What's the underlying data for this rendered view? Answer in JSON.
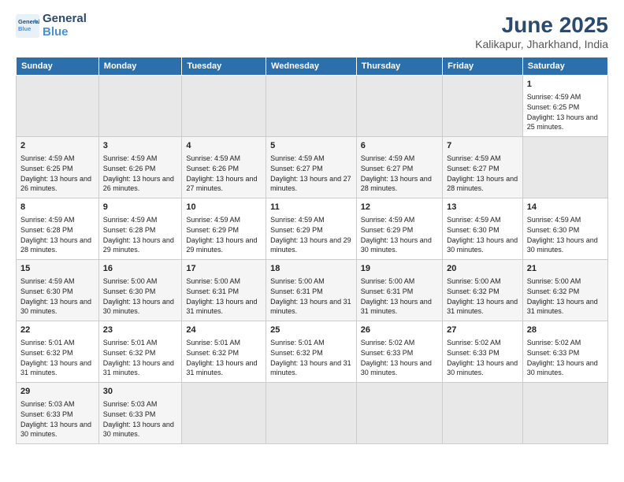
{
  "header": {
    "logo_general": "General",
    "logo_blue": "Blue",
    "title": "June 2025",
    "subtitle": "Kalikapur, Jharkhand, India"
  },
  "calendar": {
    "days": [
      "Sunday",
      "Monday",
      "Tuesday",
      "Wednesday",
      "Thursday",
      "Friday",
      "Saturday"
    ],
    "weeks": [
      [
        null,
        null,
        null,
        null,
        null,
        null,
        {
          "day": "1",
          "sunrise": "Sunrise: 4:59 AM",
          "sunset": "Sunset: 6:25 PM",
          "daylight": "Daylight: 13 hours and 25 minutes."
        }
      ],
      [
        {
          "day": "2",
          "sunrise": "Sunrise: 4:59 AM",
          "sunset": "Sunset: 6:25 PM",
          "daylight": "Daylight: 13 hours and 26 minutes."
        },
        {
          "day": "3",
          "sunrise": "Sunrise: 4:59 AM",
          "sunset": "Sunset: 6:26 PM",
          "daylight": "Daylight: 13 hours and 26 minutes."
        },
        {
          "day": "4",
          "sunrise": "Sunrise: 4:59 AM",
          "sunset": "Sunset: 6:26 PM",
          "daylight": "Daylight: 13 hours and 27 minutes."
        },
        {
          "day": "5",
          "sunrise": "Sunrise: 4:59 AM",
          "sunset": "Sunset: 6:27 PM",
          "daylight": "Daylight: 13 hours and 27 minutes."
        },
        {
          "day": "6",
          "sunrise": "Sunrise: 4:59 AM",
          "sunset": "Sunset: 6:27 PM",
          "daylight": "Daylight: 13 hours and 28 minutes."
        },
        {
          "day": "7",
          "sunrise": "Sunrise: 4:59 AM",
          "sunset": "Sunset: 6:27 PM",
          "daylight": "Daylight: 13 hours and 28 minutes."
        },
        null
      ],
      [
        {
          "day": "8",
          "sunrise": "Sunrise: 4:59 AM",
          "sunset": "Sunset: 6:28 PM",
          "daylight": "Daylight: 13 hours and 28 minutes."
        },
        {
          "day": "9",
          "sunrise": "Sunrise: 4:59 AM",
          "sunset": "Sunset: 6:28 PM",
          "daylight": "Daylight: 13 hours and 29 minutes."
        },
        {
          "day": "10",
          "sunrise": "Sunrise: 4:59 AM",
          "sunset": "Sunset: 6:29 PM",
          "daylight": "Daylight: 13 hours and 29 minutes."
        },
        {
          "day": "11",
          "sunrise": "Sunrise: 4:59 AM",
          "sunset": "Sunset: 6:29 PM",
          "daylight": "Daylight: 13 hours and 29 minutes."
        },
        {
          "day": "12",
          "sunrise": "Sunrise: 4:59 AM",
          "sunset": "Sunset: 6:29 PM",
          "daylight": "Daylight: 13 hours and 30 minutes."
        },
        {
          "day": "13",
          "sunrise": "Sunrise: 4:59 AM",
          "sunset": "Sunset: 6:30 PM",
          "daylight": "Daylight: 13 hours and 30 minutes."
        },
        {
          "day": "14",
          "sunrise": "Sunrise: 4:59 AM",
          "sunset": "Sunset: 6:30 PM",
          "daylight": "Daylight: 13 hours and 30 minutes."
        }
      ],
      [
        {
          "day": "15",
          "sunrise": "Sunrise: 4:59 AM",
          "sunset": "Sunset: 6:30 PM",
          "daylight": "Daylight: 13 hours and 30 minutes."
        },
        {
          "day": "16",
          "sunrise": "Sunrise: 5:00 AM",
          "sunset": "Sunset: 6:30 PM",
          "daylight": "Daylight: 13 hours and 30 minutes."
        },
        {
          "day": "17",
          "sunrise": "Sunrise: 5:00 AM",
          "sunset": "Sunset: 6:31 PM",
          "daylight": "Daylight: 13 hours and 31 minutes."
        },
        {
          "day": "18",
          "sunrise": "Sunrise: 5:00 AM",
          "sunset": "Sunset: 6:31 PM",
          "daylight": "Daylight: 13 hours and 31 minutes."
        },
        {
          "day": "19",
          "sunrise": "Sunrise: 5:00 AM",
          "sunset": "Sunset: 6:31 PM",
          "daylight": "Daylight: 13 hours and 31 minutes."
        },
        {
          "day": "20",
          "sunrise": "Sunrise: 5:00 AM",
          "sunset": "Sunset: 6:32 PM",
          "daylight": "Daylight: 13 hours and 31 minutes."
        },
        {
          "day": "21",
          "sunrise": "Sunrise: 5:00 AM",
          "sunset": "Sunset: 6:32 PM",
          "daylight": "Daylight: 13 hours and 31 minutes."
        }
      ],
      [
        {
          "day": "22",
          "sunrise": "Sunrise: 5:01 AM",
          "sunset": "Sunset: 6:32 PM",
          "daylight": "Daylight: 13 hours and 31 minutes."
        },
        {
          "day": "23",
          "sunrise": "Sunrise: 5:01 AM",
          "sunset": "Sunset: 6:32 PM",
          "daylight": "Daylight: 13 hours and 31 minutes."
        },
        {
          "day": "24",
          "sunrise": "Sunrise: 5:01 AM",
          "sunset": "Sunset: 6:32 PM",
          "daylight": "Daylight: 13 hours and 31 minutes."
        },
        {
          "day": "25",
          "sunrise": "Sunrise: 5:01 AM",
          "sunset": "Sunset: 6:32 PM",
          "daylight": "Daylight: 13 hours and 31 minutes."
        },
        {
          "day": "26",
          "sunrise": "Sunrise: 5:02 AM",
          "sunset": "Sunset: 6:33 PM",
          "daylight": "Daylight: 13 hours and 30 minutes."
        },
        {
          "day": "27",
          "sunrise": "Sunrise: 5:02 AM",
          "sunset": "Sunset: 6:33 PM",
          "daylight": "Daylight: 13 hours and 30 minutes."
        },
        {
          "day": "28",
          "sunrise": "Sunrise: 5:02 AM",
          "sunset": "Sunset: 6:33 PM",
          "daylight": "Daylight: 13 hours and 30 minutes."
        }
      ],
      [
        {
          "day": "29",
          "sunrise": "Sunrise: 5:03 AM",
          "sunset": "Sunset: 6:33 PM",
          "daylight": "Daylight: 13 hours and 30 minutes."
        },
        {
          "day": "30",
          "sunrise": "Sunrise: 5:03 AM",
          "sunset": "Sunset: 6:33 PM",
          "daylight": "Daylight: 13 hours and 30 minutes."
        },
        null,
        null,
        null,
        null,
        null
      ]
    ]
  }
}
